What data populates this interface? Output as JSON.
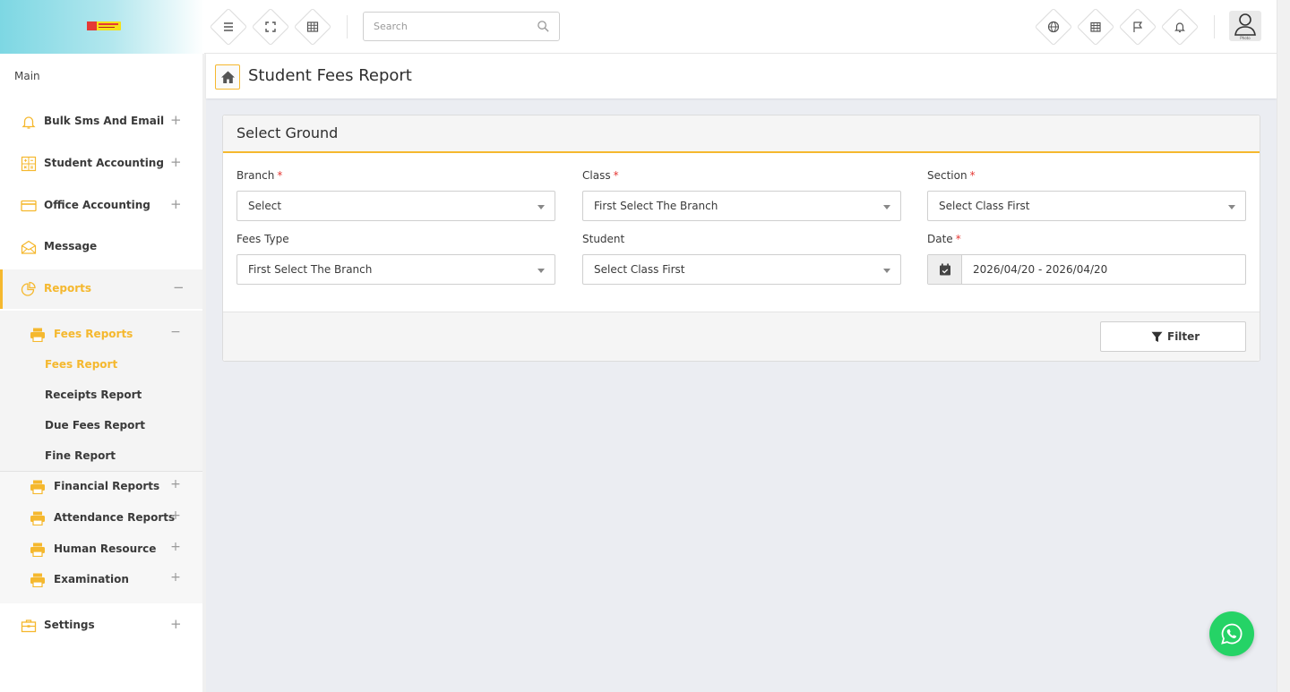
{
  "topbar": {
    "search_placeholder": "Search",
    "avatar_caption": "Photo"
  },
  "sidebar": {
    "section_label": "Main",
    "items": [
      {
        "label": "Bulk Sms And Email",
        "icon": "bell-icon",
        "toggle": "+"
      },
      {
        "label": "Student Accounting",
        "icon": "calculator-icon",
        "toggle": "+"
      },
      {
        "label": "Office Accounting",
        "icon": "credit-card-icon",
        "toggle": "+"
      },
      {
        "label": "Message",
        "icon": "envelope-icon",
        "toggle": ""
      },
      {
        "label": "Reports",
        "icon": "pie-chart-icon",
        "toggle": "−"
      },
      {
        "label": "Settings",
        "icon": "briefcase-icon",
        "toggle": "+"
      }
    ],
    "report_groups": [
      {
        "label": "Fees Reports",
        "icon": "printer-icon",
        "toggle": "−"
      },
      {
        "label": "Financial Reports",
        "icon": "printer-icon",
        "toggle": "+"
      },
      {
        "label": "Attendance Reports",
        "icon": "printer-icon",
        "toggle": "+"
      },
      {
        "label": "Human Resource",
        "icon": "printer-icon",
        "toggle": "+"
      },
      {
        "label": "Examination",
        "icon": "printer-icon",
        "toggle": "+"
      }
    ],
    "fees_links": [
      "Fees Report",
      "Receipts Report",
      "Due Fees Report",
      "Fine Report"
    ]
  },
  "page": {
    "title": "Student Fees Report"
  },
  "card": {
    "title": "Select Ground",
    "required_mark": "*",
    "fields": {
      "branch": {
        "label": "Branch",
        "value": "Select"
      },
      "class": {
        "label": "Class",
        "value": "First Select The Branch"
      },
      "section": {
        "label": "Section",
        "value": "Select Class First"
      },
      "fees_type": {
        "label": "Fees Type",
        "value": "First Select The Branch"
      },
      "student": {
        "label": "Student",
        "value": "Select Class First"
      },
      "date": {
        "label": "Date",
        "value": "2026/04/20 - 2026/04/20"
      }
    },
    "filter_label": "Filter"
  },
  "colors": {
    "accent": "#f5b82e",
    "required": "#e53935",
    "whatsapp": "#25d366"
  }
}
